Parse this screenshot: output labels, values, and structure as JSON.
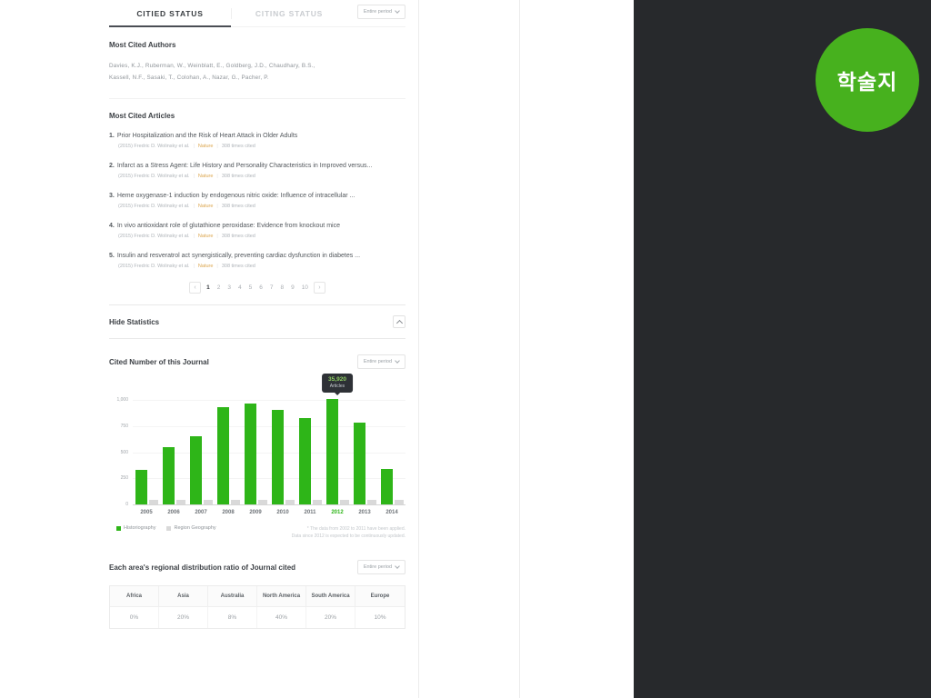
{
  "colors": {
    "accent_green": "#2eb518",
    "badge_green": "#47b11e",
    "journal_orange": "#dca54c",
    "panel_dark": "#27292c",
    "tooltip_bg": "#2e3136",
    "sub_bar_gray": "#d9d9d9"
  },
  "badge": {
    "label": "학술지"
  },
  "tabs_header": {
    "cited_tab": "CITIED STATUS",
    "citing_tab": "CITING STATUS",
    "period_dropdown": "Entire period"
  },
  "authors": {
    "title": "Most Cited Authors",
    "lines": [
      "Davies, K.J.,  Ruberman, W.,  Weinblatt, E.,  Goldberg, J.D.,  Chaudhary, B.S.,",
      "Kassell, N.F.,  Sasaki, T.,  Colohan, A.,  Nazar, G.,  Pacher, P."
    ]
  },
  "articles": {
    "title": "Most Cited Articles",
    "separator": "|",
    "items": [
      {
        "num": "1.",
        "title": "Prior Hospitalization and the Risk of Heart Attack in Older Adults",
        "year_authors": "(2015) Fredric D. Wolinsky et al.",
        "journal": "Nature",
        "cited": "308 times cited"
      },
      {
        "num": "2.",
        "title": "Infarct as a Stress Agent: Life History and Personality Characteristics in Improved versus...",
        "year_authors": "(2015) Fredric D. Wolinsky et al.",
        "journal": "Nature",
        "cited": "308 times cited"
      },
      {
        "num": "3.",
        "title": "Heme oxygenase-1 induction by endogenous nitric oxide: Influence of intracellular ...",
        "year_authors": "(2015) Fredric D. Wolinsky et al.",
        "journal": "Nature",
        "cited": "308 times cited"
      },
      {
        "num": "4.",
        "title": "In vivo antioxidant role of glutathione peroxidase: Evidence from knockout mice",
        "year_authors": "(2015) Fredric D. Wolinsky et al.",
        "journal": "Nature",
        "cited": "308 times cited"
      },
      {
        "num": "5.",
        "title": "Insulin and resveratrol act synergistically, preventing cardiac dysfunction in diabetes ...",
        "year_authors": "(2015) Fredric D. Wolinsky et al.",
        "journal": "Nature",
        "cited": "308 times cited"
      }
    ]
  },
  "pagination": {
    "prev": "‹",
    "next": "›",
    "pages": [
      "1",
      "2",
      "3",
      "4",
      "5",
      "6",
      "7",
      "8",
      "9",
      "10"
    ],
    "active": "1"
  },
  "statistics_toggle": {
    "label": "Hide Statistics"
  },
  "chart_section": {
    "title": "Cited Number of this Journal",
    "period_dropdown": "Entire period"
  },
  "chart_data": {
    "type": "bar",
    "title": "Cited Number of this Journal",
    "categories": [
      "2005",
      "2006",
      "2007",
      "2008",
      "2009",
      "2010",
      "2011",
      "2012",
      "2013",
      "2014"
    ],
    "series": [
      {
        "name": "Historiography",
        "color": "#2eb518",
        "values": [
          330,
          545,
          650,
          920,
          955,
          895,
          815,
          1000,
          780,
          335
        ]
      },
      {
        "name": "Region Geography",
        "color": "#d9d9d9",
        "values": [
          45,
          45,
          45,
          45,
          45,
          45,
          45,
          45,
          45,
          45
        ]
      }
    ],
    "xlabel": "",
    "ylabel": "",
    "ylim": [
      0,
      1000
    ],
    "yticks": [
      "1,000",
      "750",
      "500",
      "250",
      "0"
    ],
    "grid": true,
    "legend_position": "bottom-left",
    "highlight_category": "2012",
    "tooltip": {
      "value": "35,920",
      "label": "Articles",
      "target": "2012"
    },
    "footnote": [
      "* The data from 2002 to 2011 have been applied.",
      "Data since 2012 is expected to be continuously updated."
    ]
  },
  "regional_table": {
    "title": "Each area's regional distribution ratio of Journal cited",
    "period_dropdown": "Entire period",
    "columns": [
      "Africa",
      "Asia",
      "Australia",
      "North America",
      "South America",
      "Europe"
    ],
    "values": [
      "0%",
      "20%",
      "8%",
      "40%",
      "20%",
      "10%"
    ]
  }
}
